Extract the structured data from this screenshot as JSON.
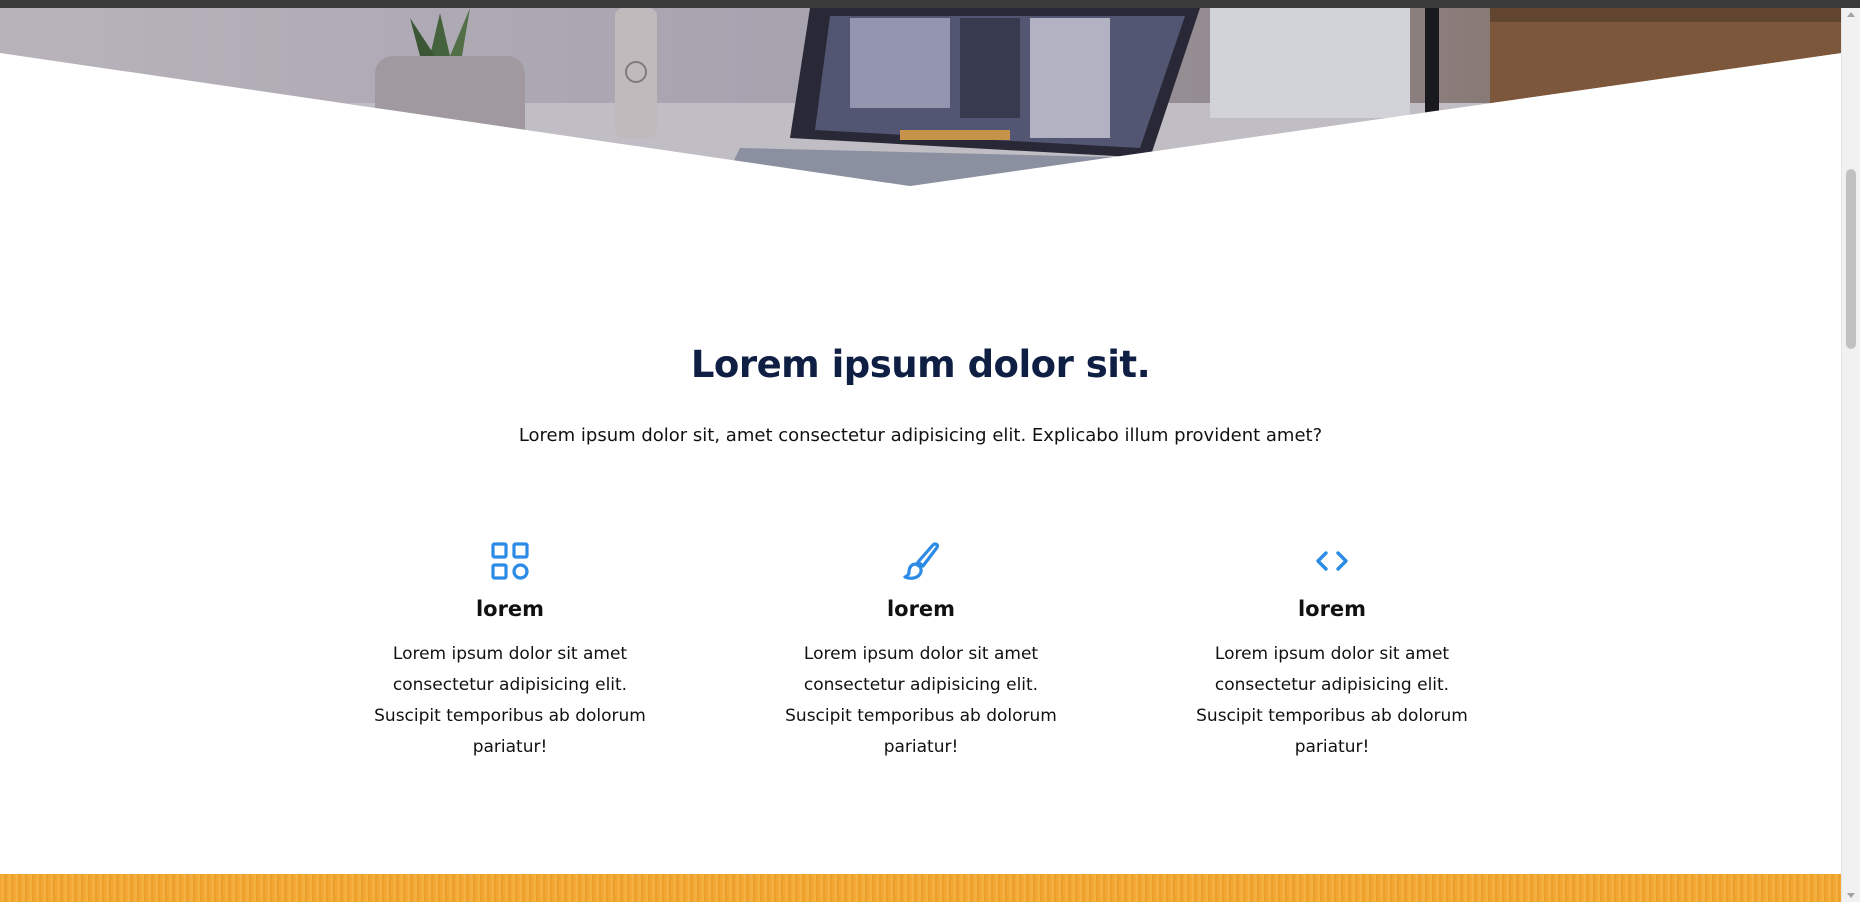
{
  "section": {
    "title": "Lorem ipsum dolor sit.",
    "subtitle": "Lorem ipsum dolor sit, amet consectetur adipisicing elit. Explicabo illum provident amet?"
  },
  "features": [
    {
      "icon": "apps-grid-icon",
      "title": "lorem",
      "text": "Lorem ipsum dolor sit amet consectetur adipisicing elit. Suscipit temporibus ab dolorum pariatur!"
    },
    {
      "icon": "paintbrush-icon",
      "title": "lorem",
      "text": "Lorem ipsum dolor sit amet consectetur adipisicing elit. Suscipit temporibus ab dolorum pariatur!"
    },
    {
      "icon": "code-brackets-icon",
      "title": "lorem",
      "text": "Lorem ipsum dolor sit amet consectetur adipisicing elit. Suscipit temporibus ab dolorum pariatur!"
    }
  ],
  "colors": {
    "accent": "#2b8be6",
    "heading": "#0f1f44",
    "band": "#f0a22e"
  }
}
